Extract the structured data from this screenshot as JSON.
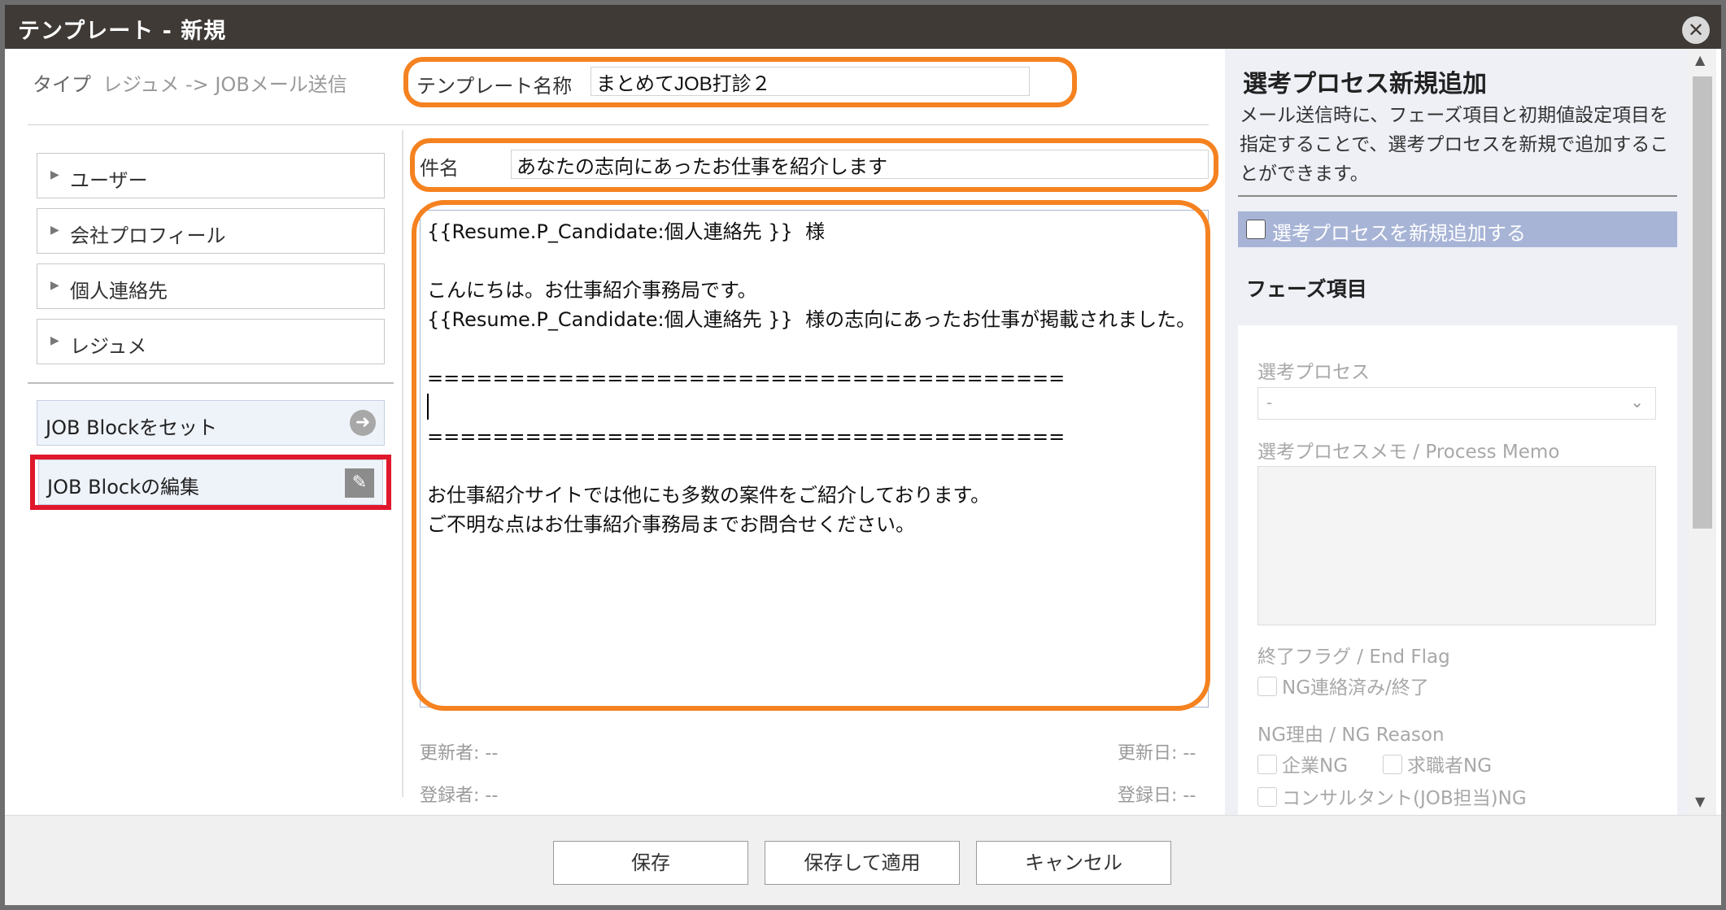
{
  "window": {
    "title": "テンプレート - 新規",
    "close_glyph": "✕"
  },
  "type_row": {
    "label": "タイプ",
    "value": "レジュメ -> JOBメール送信"
  },
  "accordion": [
    {
      "label": "ユーザー"
    },
    {
      "label": "会社プロフィール"
    },
    {
      "label": "個人連絡先"
    },
    {
      "label": "レジュメ"
    }
  ],
  "job_block": {
    "set_label": "JOB Blockをセット",
    "edit_label": "JOB Blockの編集"
  },
  "template": {
    "name_label": "テンプレート名称",
    "name_value": "まとめてJOB打診２"
  },
  "subject": {
    "label": "件名",
    "value": "あなたの志向にあったお仕事を紹介します"
  },
  "body_text": "{{Resume.P_Candidate:個人連絡先 }}  様\n\nこんにちは。お仕事紹介事務局です。\n{{Resume.P_Candidate:個人連絡先 }}  様の志向にあったお仕事が掲載されました。\n\n=======================================\n\n=======================================\n\nお仕事紹介サイトでは他にも多数の案件をご紹介しております。\nご不明な点はお仕事紹介事務局までお問合せください。",
  "meta": {
    "updated_by": "更新者: --",
    "updated_at": "更新日: --",
    "created_by": "登録者: --",
    "created_at": "登録日: --"
  },
  "right_panel": {
    "title": "選考プロセス新規追加",
    "description": "メール送信時に、フェーズ項目と初期値設定項目を指定することで、選考プロセスを新規で追加することができます。",
    "add_checkbox_label": "選考プロセスを新規追加する",
    "add_checkbox_checked": false,
    "phase_heading": "フェーズ項目",
    "process_label": "選考プロセス",
    "process_value": "-",
    "memo_label": "選考プロセスメモ / Process Memo",
    "end_flag_label": "終了フラグ / End Flag",
    "end_flag_option": "NG連絡済み/終了",
    "ng_reason_label": "NG理由 / NG Reason",
    "ng_options": [
      "企業NG",
      "求職者NG",
      "コンサルタント(JOB担当)NG"
    ]
  },
  "footer": {
    "save": "保存",
    "save_apply": "保存して適用",
    "cancel": "キャンセル"
  },
  "colors": {
    "titlebar": "#3f3a36",
    "highlight_orange": "#f58220",
    "highlight_red": "#e0182c",
    "checkbox_bar": "#a7b4d6",
    "right_panel_bg": "#eef0f6"
  },
  "icons": {
    "set_arrow": "arrow-right-circle-icon",
    "edit": "pencil-icon",
    "close": "close-icon"
  }
}
